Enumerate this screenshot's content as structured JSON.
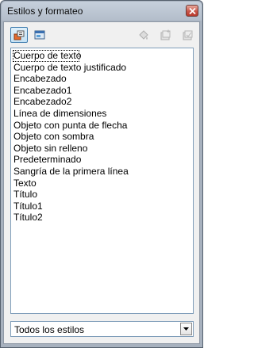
{
  "window": {
    "title": "Estilos y formateo"
  },
  "toolbar": {
    "buttons": [
      {
        "name": "paragraph-styles-icon",
        "active": true
      },
      {
        "name": "graphics-styles-icon",
        "active": false
      },
      {
        "name": "fill-format-mode-icon",
        "enabled": false
      },
      {
        "name": "new-style-from-selection-icon",
        "enabled": false
      },
      {
        "name": "update-style-icon",
        "enabled": false
      }
    ]
  },
  "styles_list": {
    "items": [
      "Cuerpo de texto",
      "Cuerpo de texto justificado",
      "Encabezado",
      "Encabezado1",
      "Encabezado2",
      "Línea de dimensiones",
      "Objeto con punta de flecha",
      "Objeto con sombra",
      "Objeto sin relleno",
      "Predeterminado",
      "Sangría de la primera línea",
      "Texto",
      "Título",
      "Título1",
      "Título2"
    ],
    "selected_index": 0
  },
  "filter": {
    "value": "Todos los estilos"
  },
  "colors": {
    "titlebar": "#b3bdca",
    "close_button": "#c9574a",
    "list_border": "#7f9db9"
  }
}
